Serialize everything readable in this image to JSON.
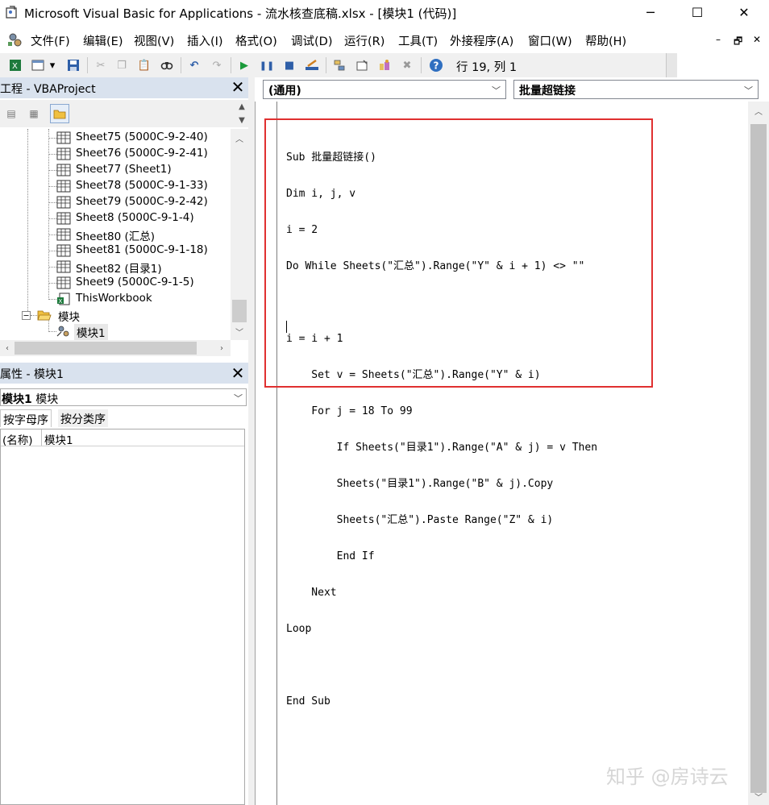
{
  "window": {
    "title": "Microsoft Visual Basic for Applications - 流水核查底稿.xlsx - [模块1 (代码)]",
    "controls": {
      "minimize": "─",
      "maximize": "☐",
      "close": "✕"
    }
  },
  "menu": {
    "items": [
      "文件(F)",
      "编辑(E)",
      "视图(V)",
      "插入(I)",
      "格式(O)",
      "调试(D)",
      "运行(R)",
      "工具(T)",
      "外接程序(A)",
      "窗口(W)",
      "帮助(H)"
    ],
    "mdi_controls": {
      "minimize": "–",
      "restore": "🗗",
      "close": "✕"
    }
  },
  "toolbar": {
    "cursor_position": "行 19, 列 1",
    "icons": [
      "excel-view-icon",
      "insert-module-icon",
      "dropdown-icon",
      "save-icon",
      "cut-icon",
      "copy-icon",
      "paste-icon",
      "find-icon",
      "undo-icon",
      "redo-icon",
      "run-icon",
      "break-icon",
      "reset-icon",
      "design-mode-icon",
      "project-explorer-icon",
      "properties-window-icon",
      "object-browser-icon",
      "toolbox-icon",
      "help-icon"
    ]
  },
  "project_pane": {
    "title": "工程 - VBAProject",
    "tree": [
      {
        "label": "Sheet75 (5000C-9-2-40)",
        "type": "sheet"
      },
      {
        "label": "Sheet76 (5000C-9-2-41)",
        "type": "sheet"
      },
      {
        "label": "Sheet77 (Sheet1)",
        "type": "sheet"
      },
      {
        "label": "Sheet78 (5000C-9-1-33)",
        "type": "sheet"
      },
      {
        "label": "Sheet79 (5000C-9-2-42)",
        "type": "sheet"
      },
      {
        "label": "Sheet8 (5000C-9-1-4)",
        "type": "sheet"
      },
      {
        "label": "Sheet80 (汇总)",
        "type": "sheet"
      },
      {
        "label": "Sheet81 (5000C-9-1-18)",
        "type": "sheet"
      },
      {
        "label": "Sheet82 (目录1)",
        "type": "sheet"
      },
      {
        "label": "Sheet9 (5000C-9-1-5)",
        "type": "sheet"
      },
      {
        "label": "ThisWorkbook",
        "type": "workbook"
      },
      {
        "label": "模块",
        "type": "folder"
      },
      {
        "label": "模块1",
        "type": "module"
      }
    ]
  },
  "properties_pane": {
    "title": "属性 - 模块1",
    "object_name": "模块1",
    "object_type": "模块",
    "tabs": [
      "按字母序",
      "按分类序"
    ],
    "rows": [
      {
        "name": "(名称)",
        "value": "模块1"
      }
    ]
  },
  "code_window": {
    "object_combo": "(通用)",
    "procedure_combo": "批量超链接",
    "lines": [
      "Sub 批量超链接()",
      "Dim i, j, v",
      "i = 2",
      "Do While Sheets(\"汇总\").Range(\"Y\" & i + 1) <> \"\"",
      "",
      "i = i + 1",
      "    Set v = Sheets(\"汇总\").Range(\"Y\" & i)",
      "    For j = 18 To 99",
      "        If Sheets(\"目录1\").Range(\"A\" & j) = v Then",
      "        Sheets(\"目录1\").Range(\"B\" & j).Copy",
      "        Sheets(\"汇总\").Paste Range(\"Z\" & i)",
      "        End If",
      "    Next",
      "Loop",
      "",
      "End Sub"
    ]
  },
  "watermark": "知乎 @房诗云",
  "colors": {
    "pane_title_bg": "#d9e2ee",
    "highlight_box": "#e03030"
  }
}
